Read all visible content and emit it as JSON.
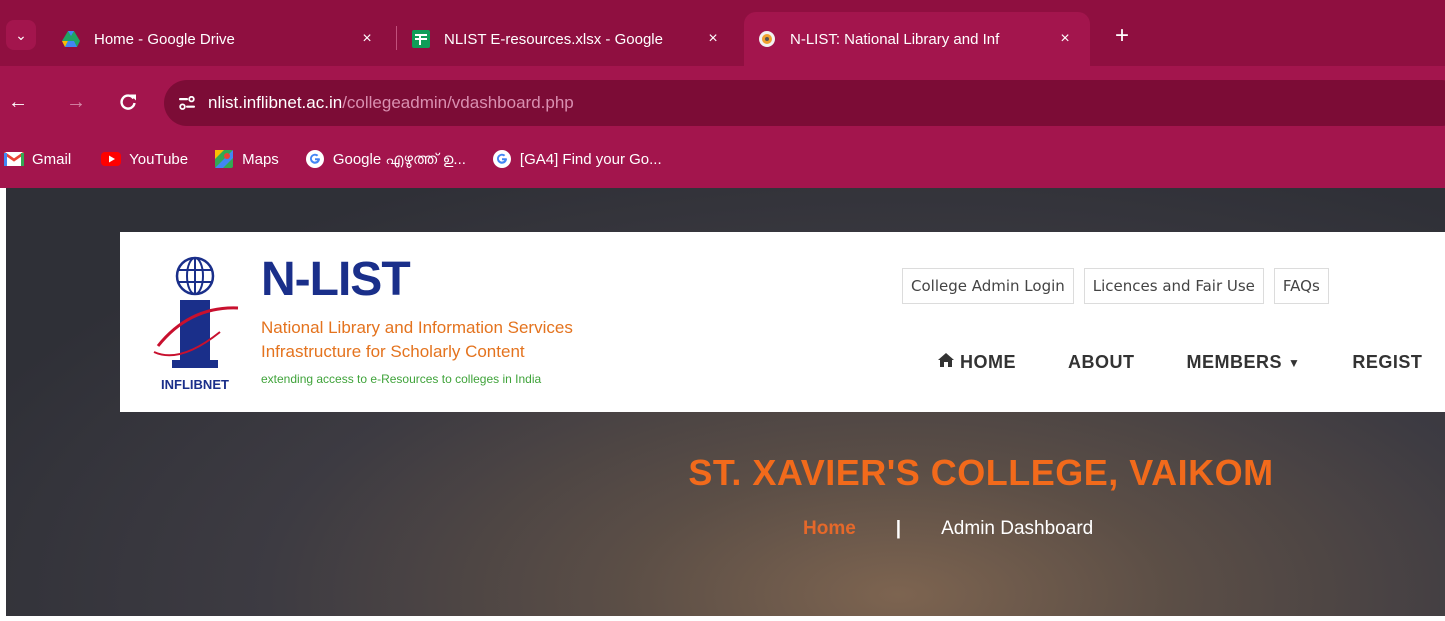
{
  "browser": {
    "tabs": [
      {
        "label": "Home - Google Drive",
        "icon": "google-drive-icon"
      },
      {
        "label": "NLIST E-resources.xlsx - Google",
        "icon": "google-sheets-icon"
      },
      {
        "label": "N-LIST: National Library and Inf",
        "icon": "nlist-favicon-icon",
        "active": true
      }
    ],
    "new_tab": "+",
    "close": "×",
    "url_host": "nlist.inflibnet.ac.in",
    "url_path": "/collegeadmin/vdashboard.php",
    "bookmarks": [
      {
        "label": "Gmail",
        "icon": "gmail-icon"
      },
      {
        "label": "YouTube",
        "icon": "youtube-icon"
      },
      {
        "label": "Maps",
        "icon": "maps-icon"
      },
      {
        "label": "Google എഴുത്ത് ഉ...",
        "icon": "google-icon"
      },
      {
        "label": "[GA4] Find your Go...",
        "icon": "google-icon"
      }
    ],
    "colors": {
      "chrome": "#a3154d",
      "tabstrip": "#8f0f40",
      "omnibox": "#7c0c36"
    }
  },
  "site": {
    "logo": {
      "org": "INFLIBNET",
      "title": "N-LIST",
      "line1": "National Library and Information Services",
      "line2": "Infrastructure for Scholarly Content",
      "tagline": "extending access to e-Resources to colleges in India"
    },
    "top_links": [
      "College Admin Login",
      "Licences and Fair Use",
      "FAQs"
    ],
    "nav": {
      "home": "HOME",
      "about": "ABOUT",
      "members": "MEMBERS",
      "register": "REGIST"
    },
    "college_name": "ST. XAVIER'S COLLEGE, VAIKOM",
    "breadcrumb": {
      "home": "Home",
      "separator": "|",
      "current": "Admin Dashboard"
    },
    "colors": {
      "brand_blue": "#1a2f8a",
      "accent_orange": "#f26a1b",
      "tag_green": "#3fa33a"
    }
  }
}
